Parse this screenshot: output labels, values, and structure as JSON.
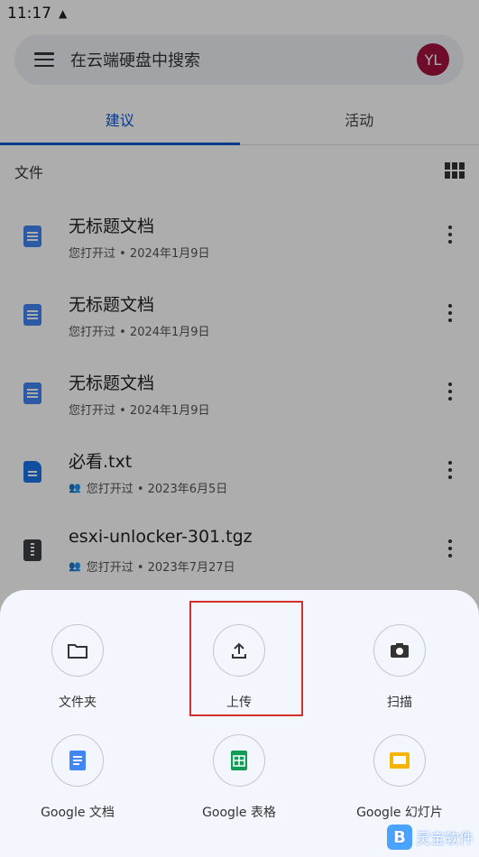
{
  "status_bar": {
    "time": "11:17"
  },
  "search": {
    "placeholder": "在云端硬盘中搜索",
    "avatar_initials": "YL"
  },
  "tabs": [
    {
      "label": "建议",
      "active": true
    },
    {
      "label": "活动",
      "active": false
    }
  ],
  "section": {
    "label": "文件"
  },
  "files": [
    {
      "name": "无标题文档",
      "subtitle": "您打开过 • 2024年1月9日",
      "type": "doc",
      "shared": false
    },
    {
      "name": "无标题文档",
      "subtitle": "您打开过 • 2024年1月9日",
      "type": "doc",
      "shared": false
    },
    {
      "name": "无标题文档",
      "subtitle": "您打开过 • 2024年1月9日",
      "type": "doc",
      "shared": false
    },
    {
      "name": "必看.txt",
      "subtitle": "您打开过 • 2023年6月5日",
      "type": "txt",
      "shared": true
    },
    {
      "name": "esxi-unlocker-301.tgz",
      "subtitle": "您打开过 • 2023年7月27日",
      "type": "zip",
      "shared": true
    }
  ],
  "create_sheet": {
    "actions": [
      {
        "label": "文件夹",
        "icon": "folder-icon"
      },
      {
        "label": "上传",
        "icon": "upload-icon"
      },
      {
        "label": "扫描",
        "icon": "camera-icon"
      },
      {
        "label": "Google 文档",
        "icon": "google-docs-icon"
      },
      {
        "label": "Google 表格",
        "icon": "google-sheets-icon"
      },
      {
        "label": "Google 幻灯片",
        "icon": "google-slides-icon"
      }
    ]
  },
  "watermark": {
    "text": "灵宝软件"
  },
  "colors": {
    "accent": "#0b57d0",
    "avatar_bg": "#a3123f",
    "highlight": "#d32f2f"
  }
}
